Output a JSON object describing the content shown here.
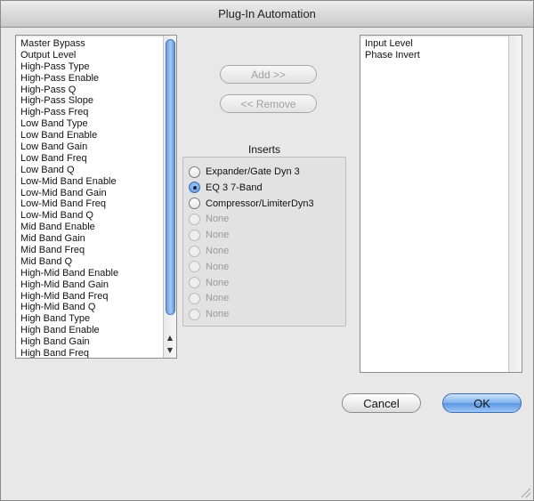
{
  "window": {
    "title": "Plug-In Automation"
  },
  "available_list": {
    "items": [
      "Master Bypass",
      "Output Level",
      "High-Pass Type",
      "High-Pass Enable",
      "High-Pass Q",
      "High-Pass Slope",
      "High-Pass Freq",
      "Low Band Type",
      "Low Band Enable",
      "Low Band Gain",
      "Low Band Freq",
      "Low Band Q",
      "Low-Mid Band Enable",
      "Low-Mid Band Gain",
      "Low-Mid Band Freq",
      "Low-Mid Band Q",
      "Mid Band Enable",
      "Mid Band Gain",
      "Mid Band Freq",
      "Mid Band Q",
      "High-Mid Band Enable",
      "High-Mid Band Gain",
      "High-Mid Band Freq",
      "High-Mid Band Q",
      "High Band Type",
      "High Band Enable",
      "High Band Gain",
      "High Band Freq"
    ]
  },
  "actions": {
    "add_label": "Add >>",
    "remove_label": "<< Remove"
  },
  "inserts": {
    "label": "Inserts",
    "options": [
      {
        "label": "Expander/Gate Dyn 3",
        "selected": false,
        "enabled": true
      },
      {
        "label": "EQ 3 7-Band",
        "selected": true,
        "enabled": true
      },
      {
        "label": "Compressor/LimiterDyn3",
        "selected": false,
        "enabled": true
      },
      {
        "label": "None",
        "selected": false,
        "enabled": false
      },
      {
        "label": "None",
        "selected": false,
        "enabled": false
      },
      {
        "label": "None",
        "selected": false,
        "enabled": false
      },
      {
        "label": "None",
        "selected": false,
        "enabled": false
      },
      {
        "label": "None",
        "selected": false,
        "enabled": false
      },
      {
        "label": "None",
        "selected": false,
        "enabled": false
      },
      {
        "label": "None",
        "selected": false,
        "enabled": false
      }
    ]
  },
  "automated_list": {
    "items": [
      "Input Level",
      "Phase Invert"
    ]
  },
  "buttons": {
    "cancel_label": "Cancel",
    "ok_label": "OK"
  },
  "colors": {
    "accent": "#5b96e4",
    "window_bg": "#e8e8e8"
  }
}
